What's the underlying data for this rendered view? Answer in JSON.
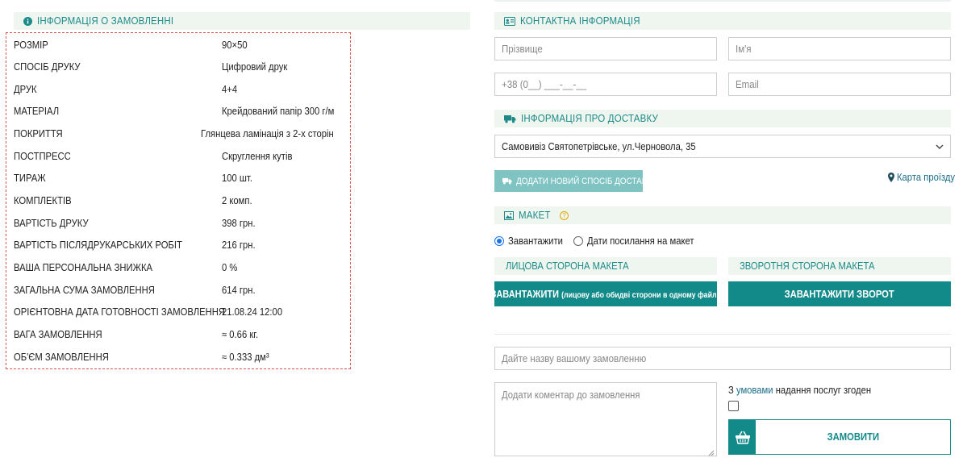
{
  "order_info": {
    "title": "ІНФОРМАЦІЯ О ЗАМОВЛЕННІ",
    "rows": [
      {
        "label": "РОЗМІР",
        "value": "90×50"
      },
      {
        "label": "СПОСІБ ДРУКУ",
        "value": "Цифровий друк"
      },
      {
        "label": "ДРУК",
        "value": "4+4"
      },
      {
        "label": "МАТЕРІАЛ",
        "value": "Крейдований папір 300 г/м"
      },
      {
        "label": "ПОКРИТТЯ",
        "value": "Глянцева ламінація з 2-х сторін"
      },
      {
        "label": "ПОСТПРЕСС",
        "value": "Скруглення кутів"
      },
      {
        "label": "ТИРАЖ",
        "value": "100 шт."
      },
      {
        "label": "КОМПЛЕКТІВ",
        "value": "2 комп."
      },
      {
        "label": "ВАРТІСТЬ ДРУКУ",
        "value": "398 грн."
      },
      {
        "label": "ВАРТІСТЬ ПІСЛЯДРУКАРСЬКИХ РОБІТ",
        "value": "216 грн."
      },
      {
        "label": "ВАША ПЕРСОНАЛЬНА ЗНИЖКА",
        "value": "0 %"
      },
      {
        "label": "ЗАГАЛЬНА СУМА ЗАМОВЛЕННЯ",
        "value": "614 грн."
      },
      {
        "label": "ОРІЄНТОВНА ДАТА ГОТОВНОСТІ ЗАМОВЛЕННЯ",
        "value": "21.08.24 12:00"
      },
      {
        "label": "ВАГА ЗАМОВЛЕННЯ",
        "value": "≈ 0.66 кг."
      },
      {
        "label": "ОБ'ЄМ ЗАМОВЛЕННЯ",
        "value": "≈ 0.333 дм³"
      }
    ]
  },
  "contact": {
    "title": "КОНТАКТНА ІНФОРМАЦІЯ",
    "surname_placeholder": "Прізвище",
    "name_placeholder": "Ім'я",
    "phone_placeholder": "+38 (0__) ___-__-__",
    "email_placeholder": "Email"
  },
  "delivery": {
    "title": "ІНФОРМАЦІЯ ПРО ДОСТАВКУ",
    "selected": "Самовивіз Святопетрівське, ул.Черновола, 35",
    "add_button": "ДОДАТИ НОВИЙ СПОСІБ ДОСТАВКИ",
    "map_link": "Карта проїзду"
  },
  "layout_section": {
    "title": "МАКЕТ",
    "help": "?",
    "option_upload": "Завантажити",
    "option_link": "Дати посилання на макет",
    "front_title": "ЛИЦОВА СТОРОНА МАКЕТА",
    "back_title": "ЗВОРОТНЯ СТОРОНА МАКЕТА",
    "front_button": "ЗАВАНТАЖИТИ",
    "front_button_note": "(лицову або обидві сторони в одному файлі)",
    "back_button": "ЗАВАНТАЖИТИ ЗВОРОТ"
  },
  "final": {
    "order_name_placeholder": "Дайте назву вашому замовленню",
    "comment_placeholder": "Додати коментар до замовлення",
    "terms_prefix": "З",
    "terms_link": "умовами",
    "terms_suffix": "надання послуг згоден",
    "submit": "ЗАМОВИТИ"
  },
  "colors": {
    "accent": "#138a8a",
    "header_bg": "#eef6ef",
    "dashed_border": "#d9534f",
    "disabled_button": "#7fc3c3"
  }
}
